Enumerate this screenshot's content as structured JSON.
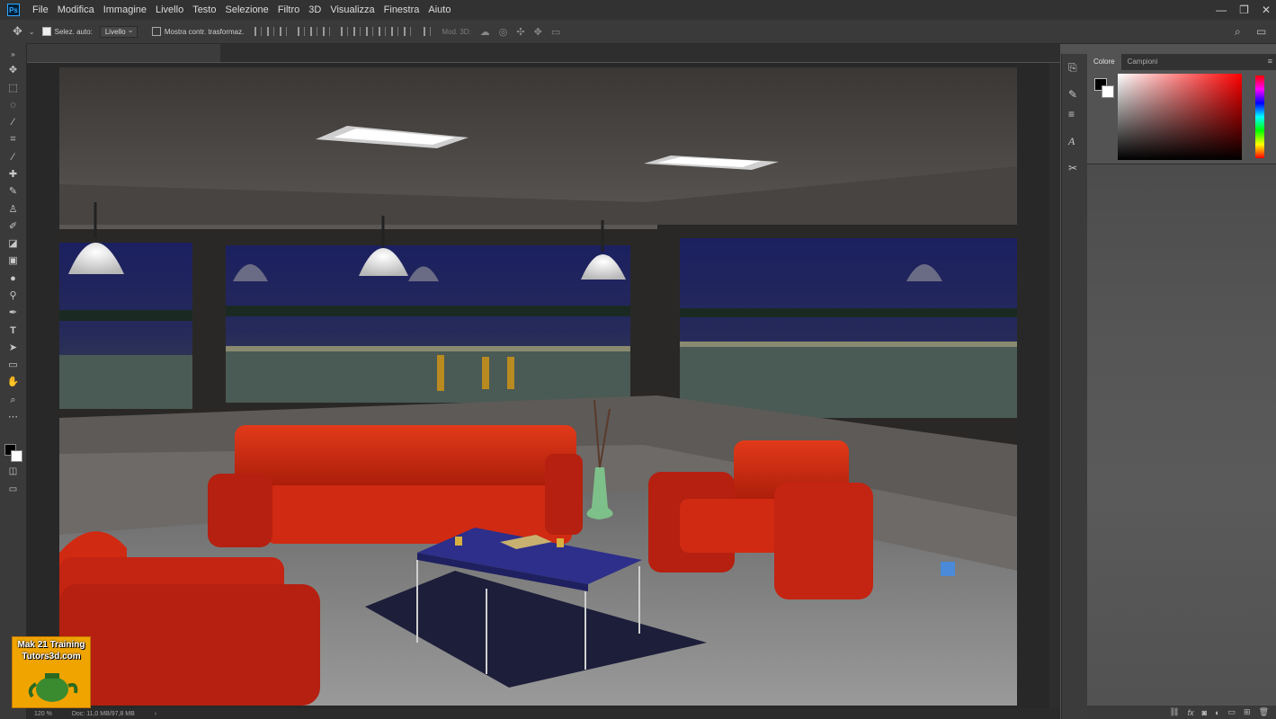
{
  "app": {
    "logo_text": "Ps"
  },
  "menu": [
    "File",
    "Modifica",
    "Immagine",
    "Livello",
    "Testo",
    "Selezione",
    "Filtro",
    "3D",
    "Visualizza",
    "Finestra",
    "Aiuto"
  ],
  "window_controls": {
    "minimize": "—",
    "restore": "❐",
    "close": "✕"
  },
  "options": {
    "auto_select_label": "Selez. auto:",
    "auto_select_checked": true,
    "target_value": "Livello",
    "transform_label": "Mostra contr. trasformaz.",
    "mode3d_label": "Mod. 3D:"
  },
  "panel_tabs": {
    "color": "Colore",
    "swatches": "Campioni"
  },
  "status": {
    "zoom": "120 %",
    "doc": "Doc: 11,0 MB/97,8 MB"
  },
  "watermark": {
    "line1": "Mak 21 Training",
    "line2": "Tutors3d.com"
  }
}
